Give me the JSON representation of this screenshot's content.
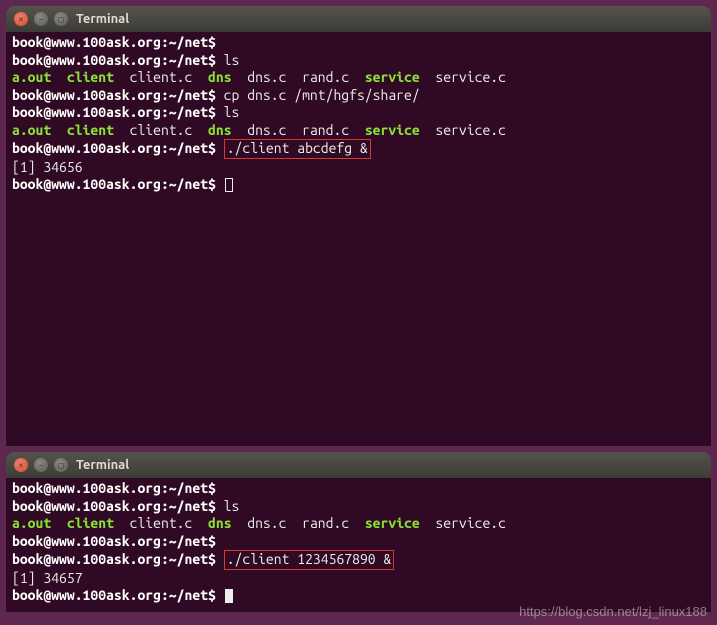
{
  "windows": [
    {
      "title": "Terminal",
      "prompt": "book@www.100ask.org:~/net$",
      "lines": [
        {
          "type": "prompt",
          "cmd": ""
        },
        {
          "type": "prompt",
          "cmd": "ls"
        },
        {
          "type": "ls",
          "items": "a.out  client  client.c  dns  dns.c  rand.c  service  service.c"
        },
        {
          "type": "prompt",
          "cmd": "cp dns.c /mnt/hgfs/share/"
        },
        {
          "type": "prompt",
          "cmd": "ls"
        },
        {
          "type": "ls",
          "items": "a.out  client  client.c  dns  dns.c  rand.c  service  service.c"
        },
        {
          "type": "prompt_boxed",
          "cmd": "./client abcdefg &"
        },
        {
          "type": "plain",
          "text": "[1] 34656"
        },
        {
          "type": "prompt_cursor"
        }
      ]
    },
    {
      "title": "Terminal",
      "prompt": "book@www.100ask.org:~/net$",
      "lines": [
        {
          "type": "prompt",
          "cmd": ""
        },
        {
          "type": "prompt",
          "cmd": "ls"
        },
        {
          "type": "ls",
          "items": "a.out  client  client.c  dns  dns.c  rand.c  service  service.c"
        },
        {
          "type": "prompt",
          "cmd": ""
        },
        {
          "type": "prompt_boxed",
          "cmd": "./client 1234567890 &"
        },
        {
          "type": "plain",
          "text": "[1] 34657"
        },
        {
          "type": "prompt_cursor_solid"
        }
      ]
    }
  ],
  "ls_green": [
    "a.out",
    "client",
    "dns",
    "service"
  ],
  "watermark": "https://blog.csdn.net/lzj_linux188"
}
